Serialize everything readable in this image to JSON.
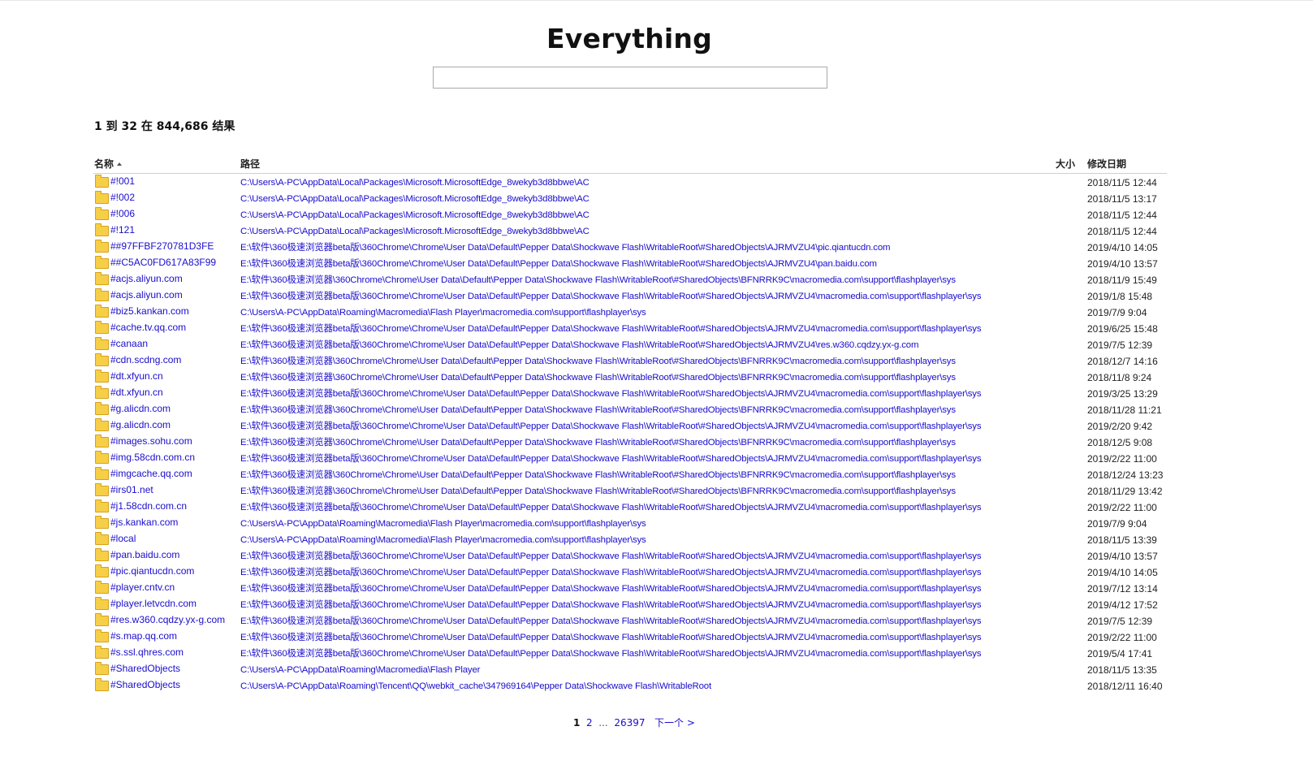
{
  "app": {
    "title": "Everything"
  },
  "search": {
    "value": "",
    "placeholder": ""
  },
  "results_summary": "1 到 32 在 844,686 结果",
  "columns": {
    "name": "名称",
    "path": "路径",
    "size": "大小",
    "modified": "修改日期"
  },
  "rows": [
    {
      "name": "#!001",
      "path": "C:\\Users\\A-PC\\AppData\\Local\\Packages\\Microsoft.MicrosoftEdge_8wekyb3d8bbwe\\AC",
      "size": "",
      "date": "2018/11/5 12:44"
    },
    {
      "name": "#!002",
      "path": "C:\\Users\\A-PC\\AppData\\Local\\Packages\\Microsoft.MicrosoftEdge_8wekyb3d8bbwe\\AC",
      "size": "",
      "date": "2018/11/5 13:17"
    },
    {
      "name": "#!006",
      "path": "C:\\Users\\A-PC\\AppData\\Local\\Packages\\Microsoft.MicrosoftEdge_8wekyb3d8bbwe\\AC",
      "size": "",
      "date": "2018/11/5 12:44"
    },
    {
      "name": "#!121",
      "path": "C:\\Users\\A-PC\\AppData\\Local\\Packages\\Microsoft.MicrosoftEdge_8wekyb3d8bbwe\\AC",
      "size": "",
      "date": "2018/11/5 12:44"
    },
    {
      "name": "##97FFBF270781D3FE",
      "path": "E:\\软件\\360极速浏览器beta版\\360Chrome\\Chrome\\User Data\\Default\\Pepper Data\\Shockwave Flash\\WritableRoot\\#SharedObjects\\AJRMVZU4\\pic.qiantucdn.com",
      "size": "",
      "date": "2019/4/10 14:05"
    },
    {
      "name": "##C5AC0FD617A83F99",
      "path": "E:\\软件\\360极速浏览器beta版\\360Chrome\\Chrome\\User Data\\Default\\Pepper Data\\Shockwave Flash\\WritableRoot\\#SharedObjects\\AJRMVZU4\\pan.baidu.com",
      "size": "",
      "date": "2019/4/10 13:57"
    },
    {
      "name": "#acjs.aliyun.com",
      "path": "E:\\软件\\360极速浏览器\\360Chrome\\Chrome\\User Data\\Default\\Pepper Data\\Shockwave Flash\\WritableRoot\\#SharedObjects\\BFNRRK9C\\macromedia.com\\support\\flashplayer\\sys",
      "size": "",
      "date": "2018/11/9 15:49"
    },
    {
      "name": "#acjs.aliyun.com",
      "path": "E:\\软件\\360极速浏览器beta版\\360Chrome\\Chrome\\User Data\\Default\\Pepper Data\\Shockwave Flash\\WritableRoot\\#SharedObjects\\AJRMVZU4\\macromedia.com\\support\\flashplayer\\sys",
      "size": "",
      "date": "2019/1/8 15:48"
    },
    {
      "name": "#biz5.kankan.com",
      "path": "C:\\Users\\A-PC\\AppData\\Roaming\\Macromedia\\Flash Player\\macromedia.com\\support\\flashplayer\\sys",
      "size": "",
      "date": "2019/7/9 9:04"
    },
    {
      "name": "#cache.tv.qq.com",
      "path": "E:\\软件\\360极速浏览器beta版\\360Chrome\\Chrome\\User Data\\Default\\Pepper Data\\Shockwave Flash\\WritableRoot\\#SharedObjects\\AJRMVZU4\\macromedia.com\\support\\flashplayer\\sys",
      "size": "",
      "date": "2019/6/25 15:48"
    },
    {
      "name": "#canaan",
      "path": "E:\\软件\\360极速浏览器beta版\\360Chrome\\Chrome\\User Data\\Default\\Pepper Data\\Shockwave Flash\\WritableRoot\\#SharedObjects\\AJRMVZU4\\res.w360.cqdzy.yx-g.com",
      "size": "",
      "date": "2019/7/5 12:39"
    },
    {
      "name": "#cdn.scdng.com",
      "path": "E:\\软件\\360极速浏览器\\360Chrome\\Chrome\\User Data\\Default\\Pepper Data\\Shockwave Flash\\WritableRoot\\#SharedObjects\\BFNRRK9C\\macromedia.com\\support\\flashplayer\\sys",
      "size": "",
      "date": "2018/12/7 14:16"
    },
    {
      "name": "#dt.xfyun.cn",
      "path": "E:\\软件\\360极速浏览器\\360Chrome\\Chrome\\User Data\\Default\\Pepper Data\\Shockwave Flash\\WritableRoot\\#SharedObjects\\BFNRRK9C\\macromedia.com\\support\\flashplayer\\sys",
      "size": "",
      "date": "2018/11/8 9:24"
    },
    {
      "name": "#dt.xfyun.cn",
      "path": "E:\\软件\\360极速浏览器beta版\\360Chrome\\Chrome\\User Data\\Default\\Pepper Data\\Shockwave Flash\\WritableRoot\\#SharedObjects\\AJRMVZU4\\macromedia.com\\support\\flashplayer\\sys",
      "size": "",
      "date": "2019/3/25 13:29"
    },
    {
      "name": "#g.alicdn.com",
      "path": "E:\\软件\\360极速浏览器\\360Chrome\\Chrome\\User Data\\Default\\Pepper Data\\Shockwave Flash\\WritableRoot\\#SharedObjects\\BFNRRK9C\\macromedia.com\\support\\flashplayer\\sys",
      "size": "",
      "date": "2018/11/28 11:21"
    },
    {
      "name": "#g.alicdn.com",
      "path": "E:\\软件\\360极速浏览器beta版\\360Chrome\\Chrome\\User Data\\Default\\Pepper Data\\Shockwave Flash\\WritableRoot\\#SharedObjects\\AJRMVZU4\\macromedia.com\\support\\flashplayer\\sys",
      "size": "",
      "date": "2019/2/20 9:42"
    },
    {
      "name": "#images.sohu.com",
      "path": "E:\\软件\\360极速浏览器\\360Chrome\\Chrome\\User Data\\Default\\Pepper Data\\Shockwave Flash\\WritableRoot\\#SharedObjects\\BFNRRK9C\\macromedia.com\\support\\flashplayer\\sys",
      "size": "",
      "date": "2018/12/5 9:08"
    },
    {
      "name": "#img.58cdn.com.cn",
      "path": "E:\\软件\\360极速浏览器beta版\\360Chrome\\Chrome\\User Data\\Default\\Pepper Data\\Shockwave Flash\\WritableRoot\\#SharedObjects\\AJRMVZU4\\macromedia.com\\support\\flashplayer\\sys",
      "size": "",
      "date": "2019/2/22 11:00"
    },
    {
      "name": "#imgcache.qq.com",
      "path": "E:\\软件\\360极速浏览器\\360Chrome\\Chrome\\User Data\\Default\\Pepper Data\\Shockwave Flash\\WritableRoot\\#SharedObjects\\BFNRRK9C\\macromedia.com\\support\\flashplayer\\sys",
      "size": "",
      "date": "2018/12/24 13:23"
    },
    {
      "name": "#irs01.net",
      "path": "E:\\软件\\360极速浏览器\\360Chrome\\Chrome\\User Data\\Default\\Pepper Data\\Shockwave Flash\\WritableRoot\\#SharedObjects\\BFNRRK9C\\macromedia.com\\support\\flashplayer\\sys",
      "size": "",
      "date": "2018/11/29 13:42"
    },
    {
      "name": "#j1.58cdn.com.cn",
      "path": "E:\\软件\\360极速浏览器beta版\\360Chrome\\Chrome\\User Data\\Default\\Pepper Data\\Shockwave Flash\\WritableRoot\\#SharedObjects\\AJRMVZU4\\macromedia.com\\support\\flashplayer\\sys",
      "size": "",
      "date": "2019/2/22 11:00"
    },
    {
      "name": "#js.kankan.com",
      "path": "C:\\Users\\A-PC\\AppData\\Roaming\\Macromedia\\Flash Player\\macromedia.com\\support\\flashplayer\\sys",
      "size": "",
      "date": "2019/7/9 9:04"
    },
    {
      "name": "#local",
      "path": "C:\\Users\\A-PC\\AppData\\Roaming\\Macromedia\\Flash Player\\macromedia.com\\support\\flashplayer\\sys",
      "size": "",
      "date": "2018/11/5 13:39"
    },
    {
      "name": "#pan.baidu.com",
      "path": "E:\\软件\\360极速浏览器beta版\\360Chrome\\Chrome\\User Data\\Default\\Pepper Data\\Shockwave Flash\\WritableRoot\\#SharedObjects\\AJRMVZU4\\macromedia.com\\support\\flashplayer\\sys",
      "size": "",
      "date": "2019/4/10 13:57"
    },
    {
      "name": "#pic.qiantucdn.com",
      "path": "E:\\软件\\360极速浏览器beta版\\360Chrome\\Chrome\\User Data\\Default\\Pepper Data\\Shockwave Flash\\WritableRoot\\#SharedObjects\\AJRMVZU4\\macromedia.com\\support\\flashplayer\\sys",
      "size": "",
      "date": "2019/4/10 14:05"
    },
    {
      "name": "#player.cntv.cn",
      "path": "E:\\软件\\360极速浏览器beta版\\360Chrome\\Chrome\\User Data\\Default\\Pepper Data\\Shockwave Flash\\WritableRoot\\#SharedObjects\\AJRMVZU4\\macromedia.com\\support\\flashplayer\\sys",
      "size": "",
      "date": "2019/7/12 13:14"
    },
    {
      "name": "#player.letvcdn.com",
      "path": "E:\\软件\\360极速浏览器beta版\\360Chrome\\Chrome\\User Data\\Default\\Pepper Data\\Shockwave Flash\\WritableRoot\\#SharedObjects\\AJRMVZU4\\macromedia.com\\support\\flashplayer\\sys",
      "size": "",
      "date": "2019/4/12 17:52"
    },
    {
      "name": "#res.w360.cqdzy.yx-g.com",
      "path": "E:\\软件\\360极速浏览器beta版\\360Chrome\\Chrome\\User Data\\Default\\Pepper Data\\Shockwave Flash\\WritableRoot\\#SharedObjects\\AJRMVZU4\\macromedia.com\\support\\flashplayer\\sys",
      "size": "",
      "date": "2019/7/5 12:39"
    },
    {
      "name": "#s.map.qq.com",
      "path": "E:\\软件\\360极速浏览器beta版\\360Chrome\\Chrome\\User Data\\Default\\Pepper Data\\Shockwave Flash\\WritableRoot\\#SharedObjects\\AJRMVZU4\\macromedia.com\\support\\flashplayer\\sys",
      "size": "",
      "date": "2019/2/22 11:00"
    },
    {
      "name": "#s.ssl.qhres.com",
      "path": "E:\\软件\\360极速浏览器beta版\\360Chrome\\Chrome\\User Data\\Default\\Pepper Data\\Shockwave Flash\\WritableRoot\\#SharedObjects\\AJRMVZU4\\macromedia.com\\support\\flashplayer\\sys",
      "size": "",
      "date": "2019/5/4 17:41"
    },
    {
      "name": "#SharedObjects",
      "path": "C:\\Users\\A-PC\\AppData\\Roaming\\Macromedia\\Flash Player",
      "size": "",
      "date": "2018/11/5 13:35"
    },
    {
      "name": "#SharedObjects",
      "path": "C:\\Users\\A-PC\\AppData\\Roaming\\Tencent\\QQ\\webkit_cache\\347969164\\Pepper Data\\Shockwave Flash\\WritableRoot",
      "size": "",
      "date": "2018/12/11 16:40"
    }
  ],
  "pagination": {
    "current": "1",
    "next_page": "2",
    "ellipsis": "...",
    "last_page": "26397",
    "next_label": "下一个 >"
  },
  "colors": {
    "link": "#1a0dcc",
    "folder": "#f7cf47"
  },
  "icons": {
    "row_icon": "folder-icon",
    "sort_indicator": "sort-ascending-icon"
  }
}
